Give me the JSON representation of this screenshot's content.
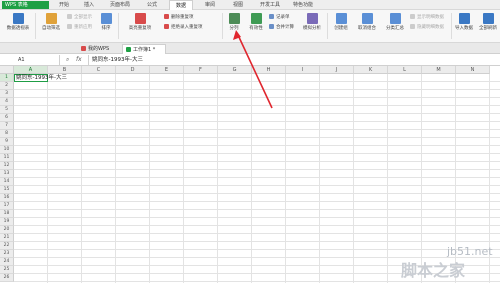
{
  "app": {
    "name": "WPS 表格"
  },
  "menu_tabs": [
    "开始",
    "插入",
    "页面布局",
    "公式",
    "数据",
    "审阅",
    "视图",
    "开发工具",
    "特色功能"
  ],
  "active_menu_tab": "数据",
  "ribbon": {
    "pivot": "数据透视表",
    "autofilter": "自动筛选",
    "show_all": "全部显示",
    "reapply": "重新应用",
    "sort": "排序",
    "highlight_dup": "高亮重复项",
    "reject_dup": "拒绝录入重复项",
    "delete_dup": "删除重复项",
    "split": "分列",
    "validity": "有效性",
    "record_form": "记录单",
    "consolidate": "合并计算",
    "whatif": "模拟分析",
    "group": "创建组",
    "ungroup": "取消组合",
    "subtotal": "分类汇总",
    "show_detail": "显示明细数据",
    "hide_detail": "隐藏明细数据",
    "import": "导入数据",
    "refresh_all": "全部刷新"
  },
  "doc_tabs": [
    {
      "label": "我的WPS",
      "active": false
    },
    {
      "label": "工作簿1 *",
      "active": true
    }
  ],
  "formula_bar": {
    "cell_ref": "A1",
    "fx": "fx",
    "content": "姚同东-1993年-大三"
  },
  "columns": [
    "A",
    "B",
    "C",
    "D",
    "E",
    "F",
    "G",
    "H",
    "I",
    "J",
    "K",
    "L",
    "M",
    "N"
  ],
  "rows": [
    "1",
    "2",
    "3",
    "4",
    "5",
    "6",
    "7",
    "8",
    "9",
    "10",
    "11",
    "12",
    "13",
    "14",
    "15",
    "16",
    "17",
    "18",
    "19",
    "20",
    "21",
    "22",
    "23",
    "24",
    "25",
    "26"
  ],
  "cells": {
    "A1": "姚同东-1993年-大三"
  },
  "watermark": {
    "site": "jb51.net",
    "brand": "脚本之家"
  },
  "colors": {
    "brand": "#1fa045",
    "annotation": "#e0262e"
  }
}
